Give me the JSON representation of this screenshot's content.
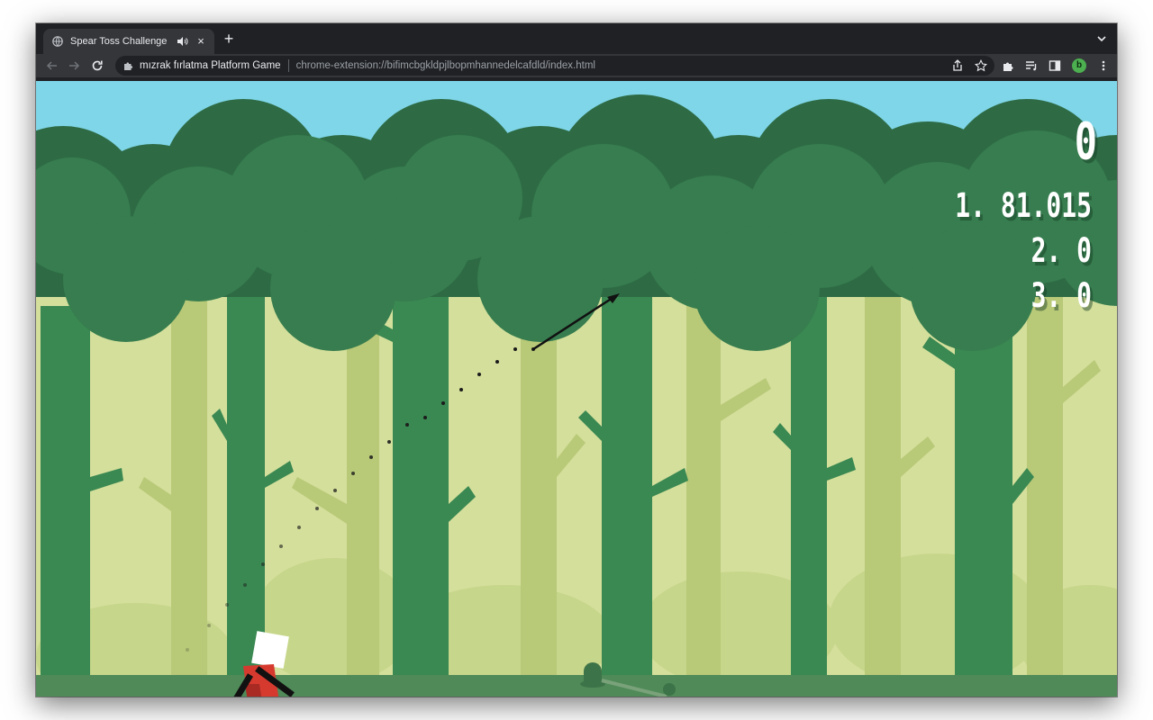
{
  "browser": {
    "tab": {
      "title": "Spear Toss Challenge",
      "favicon": "globe-icon",
      "audio_icon": "speaker-icon",
      "close": "×"
    },
    "new_tab": "+",
    "omnibox": {
      "site_name": "mızrak fırlatma Platform Game",
      "url": "chrome-extension://bifimcbgkldpjlbopmhannedelcafdld/index.html"
    },
    "profile_initial": "b",
    "accent": "#4caf50"
  },
  "game": {
    "current_distance": "0",
    "high_scores": [
      {
        "rank": "1.",
        "value": "81.015"
      },
      {
        "rank": "2.",
        "value": "0"
      },
      {
        "rank": "3.",
        "value": "0"
      }
    ],
    "colors": {
      "sky": "#7fd6e8",
      "canopy_dark": "#2e6b45",
      "canopy_mid": "#377d4f",
      "trunk_front": "#3a8852",
      "trunk_back": "#b8c978",
      "background": "#d4df9b",
      "ground": "#4f8a58",
      "player_body": "#d63a2f",
      "player_head": "#ffffff"
    }
  }
}
